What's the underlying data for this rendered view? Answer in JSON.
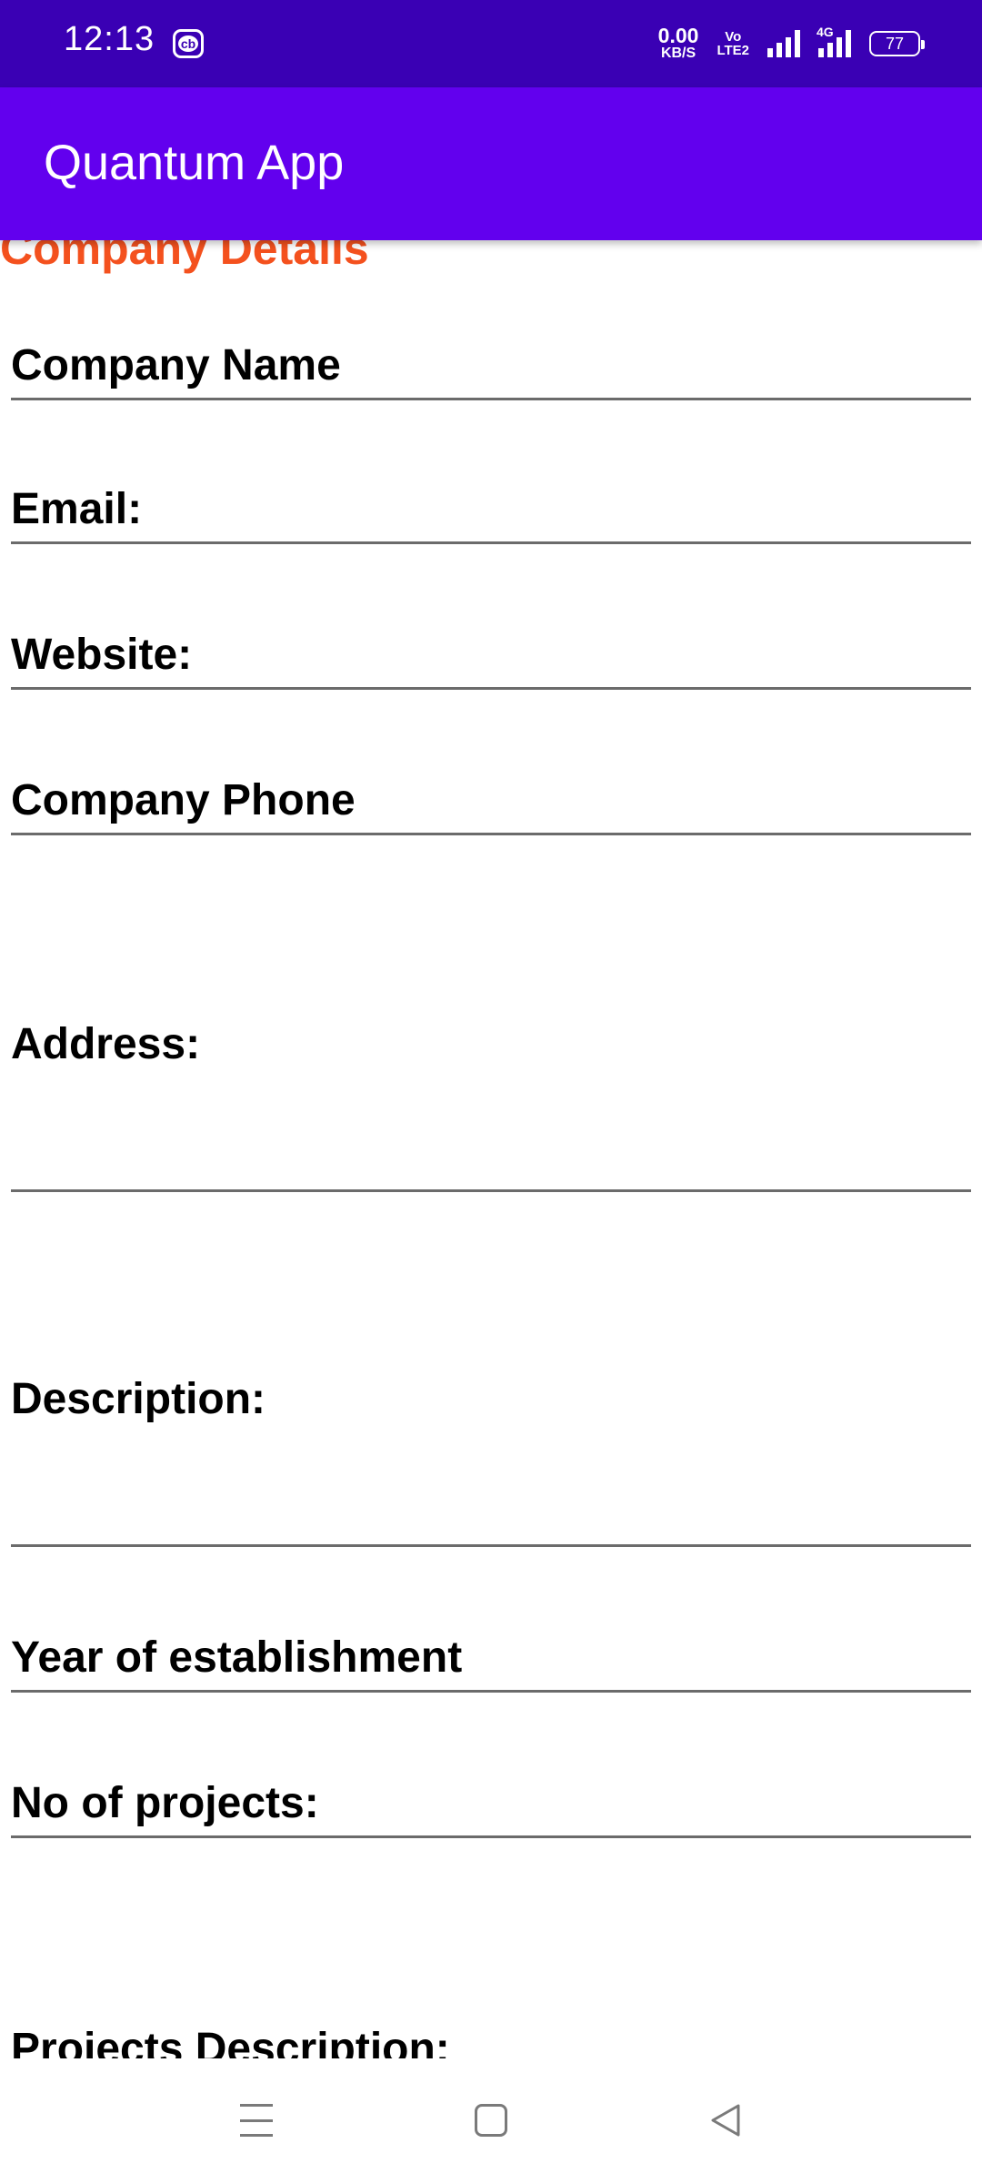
{
  "status_bar": {
    "time": "12:13",
    "cb_badge": "cb",
    "net_speed_value": "0.00",
    "net_speed_unit": "KB/S",
    "volte_top": "Vo",
    "volte_bottom": "LTE2",
    "network_type": "4G",
    "battery": "77"
  },
  "app_bar": {
    "title": "Quantum App",
    "color": "#6200ee"
  },
  "form": {
    "section_title": "Company Details",
    "section_title_color": "#f4511e",
    "fields": [
      {
        "label": "Company Name"
      },
      {
        "label": "Email:"
      },
      {
        "label": "Website:"
      },
      {
        "label": "Company Phone"
      },
      {
        "label": "Address:"
      },
      {
        "label": "Description:"
      },
      {
        "label": "Year of establishment"
      },
      {
        "label": "No of projects:"
      },
      {
        "label": "Projects Description:"
      }
    ]
  },
  "nav_bar": {
    "icons": [
      "menu-icon",
      "home-square-icon",
      "back-triangle-icon"
    ]
  }
}
